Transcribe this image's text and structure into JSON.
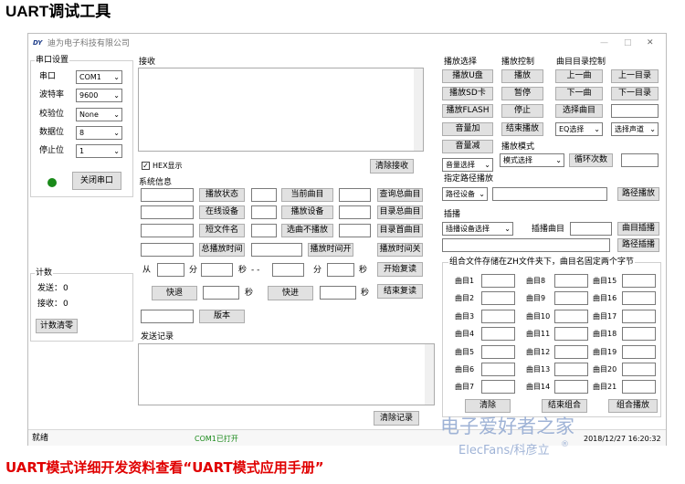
{
  "page": {
    "heading": "UART调试工具",
    "footer": "UART模式详细开发资料查看“UART模式应用手册”",
    "watermark_cn": "电子爱好者之家",
    "watermark_en": "ElecFans/科彦立",
    "watermark_mark": "®"
  },
  "window": {
    "title": "迪为电子科技有限公司",
    "logo": "DY",
    "minimize": "—",
    "maximize": "□",
    "close": "✕"
  },
  "serial": {
    "title": "串口设置",
    "port_label": "串口",
    "port_value": "COM1",
    "baud_label": "波特率",
    "baud_value": "9600",
    "parity_label": "校验位",
    "parity_value": "None",
    "data_label": "数据位",
    "data_value": "8",
    "stop_label": "停止位",
    "stop_value": "1",
    "close_btn": "关闭串口",
    "led_color": "#1a8a1a"
  },
  "count": {
    "title": "计数",
    "send_label": "发送：",
    "send_value": "0",
    "recv_label": "接收：",
    "recv_value": "0",
    "clear_btn": "计数清零"
  },
  "receive": {
    "title": "接收",
    "hex_label": "HEX显示",
    "clear_btn": "清除接收"
  },
  "sysinfo": {
    "title": "系统信息",
    "play_state": "播放状态",
    "cur_track": "当前曲目",
    "query_total": "查询总曲目",
    "online_dev": "在线设备",
    "play_dev": "播放设备",
    "dir_total": "目录总曲目",
    "short_name": "短文件名",
    "skip_track": "选曲不播放",
    "dir_first": "目录首曲目",
    "total_time": "总播放时间",
    "time_on": "播放时间开",
    "time_off": "播放时间关",
    "from": "从",
    "min1": "分",
    "sec1": "秒",
    "dash": "- -",
    "min2": "分",
    "sec2": "秒",
    "rep_start": "开始复读",
    "rewind": "快退",
    "sec3": "秒",
    "forward": "快进",
    "sec4": "秒",
    "rep_end": "结束复读",
    "version": "版本"
  },
  "send": {
    "title": "发送记录",
    "clear_btn": "清除记录"
  },
  "status": {
    "ready": "就绪",
    "port_open": "COM1已打开",
    "datetime": "2018/12/27 16:20:32"
  },
  "play_select": {
    "title": "播放选择",
    "udisk": "播放U盘",
    "sd": "播放SD卡",
    "flash": "播放FLASH",
    "vol_up": "音量加",
    "vol_down": "音量减"
  },
  "play_control": {
    "title": "播放控制",
    "play": "播放",
    "pause": "暂停",
    "stop": "停止",
    "end": "结束播放",
    "eq": "EQ选择"
  },
  "dir_control": {
    "title": "曲目目录控制",
    "prev": "上一曲",
    "prev_dir": "上一目录",
    "next": "下一曲",
    "next_dir": "下一目录",
    "select": "选择曲目",
    "channel": "选择声道"
  },
  "play_mode": {
    "title": "播放模式",
    "volume_select": "音量选择",
    "mode_select": "模式选择",
    "loop": "循环次数"
  },
  "path_play": {
    "title": "指定路径播放",
    "device": "路径设备",
    "btn": "路径播放"
  },
  "insert": {
    "title": "插播",
    "device": "插播设备选择",
    "track_label": "插播曲目",
    "track_btn": "曲目插播",
    "path_btn": "路径插播"
  },
  "combo_play": {
    "title": "组合文件存储在ZH文件夹下，曲目名固定两个字节",
    "tracks": [
      "曲目1",
      "曲目2",
      "曲目3",
      "曲目4",
      "曲目5",
      "曲目6",
      "曲目7",
      "曲目8",
      "曲目9",
      "曲目10",
      "曲目11",
      "曲目12",
      "曲目13",
      "曲目14",
      "曲目15",
      "曲目16",
      "曲目17",
      "曲目18",
      "曲目19",
      "曲目20",
      "曲目21"
    ],
    "clear": "清除",
    "end": "结束组合",
    "play": "组合播放"
  }
}
